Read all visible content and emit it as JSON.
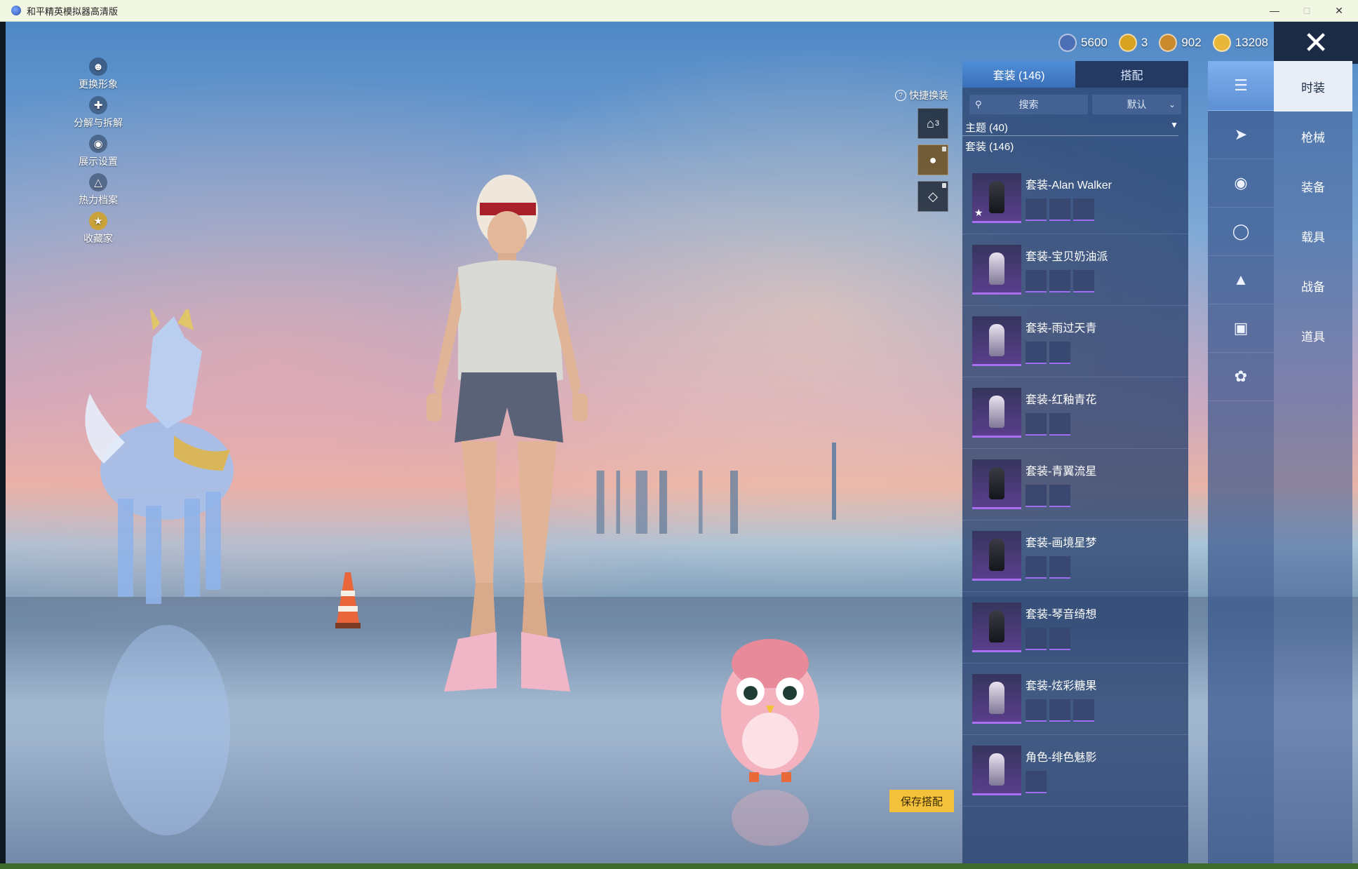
{
  "window": {
    "title": "和平精英模拟器高清版"
  },
  "currency": [
    {
      "icon": "silver-coin-icon",
      "value": "5600",
      "color": "#4c6fb5"
    },
    {
      "icon": "gold-medal-icon",
      "value": "3",
      "color": "#d6a21f"
    },
    {
      "icon": "bronze-coin-icon",
      "value": "902",
      "color": "#c98a2d"
    },
    {
      "icon": "gold-coin-icon",
      "value": "13208",
      "color": "#e8b73a"
    }
  ],
  "left_menu": [
    {
      "label": "更换形象",
      "icon": "avatar-icon"
    },
    {
      "label": "分解与拆解",
      "icon": "puzzle-icon"
    },
    {
      "label": "展示设置",
      "icon": "eye-icon"
    },
    {
      "label": "热力档案",
      "icon": "flame-icon"
    },
    {
      "label": "收藏家",
      "icon": "collector-badge-icon"
    }
  ],
  "quick_change": {
    "label": "快捷换装",
    "slot_number": "3"
  },
  "panel": {
    "tabs": [
      {
        "label": "套装 (146)"
      },
      {
        "label": "搭配"
      }
    ],
    "search_placeholder": "搜索",
    "sort_label": "默认",
    "theme_label": "主题 (40)",
    "set_count_label": "套装 (146)",
    "items": [
      {
        "name": "套装-Alan Walker",
        "minis": 3,
        "dark": true,
        "star": true
      },
      {
        "name": "套装-宝贝奶油派",
        "minis": 3,
        "dark": false,
        "star": false
      },
      {
        "name": "套装-雨过天青",
        "minis": 2,
        "dark": false,
        "star": false
      },
      {
        "name": "套装-红釉青花",
        "minis": 2,
        "dark": false,
        "star": false
      },
      {
        "name": "套装-青翼流星",
        "minis": 2,
        "dark": true,
        "star": false
      },
      {
        "name": "套装-画境星梦",
        "minis": 2,
        "dark": true,
        "star": false
      },
      {
        "name": "套装-琴音绮想",
        "minis": 2,
        "dark": true,
        "star": false
      },
      {
        "name": "套装-炫彩糖果",
        "minis": 3,
        "dark": false,
        "star": false
      },
      {
        "name": "角色-绯色魅影",
        "minis": 1,
        "dark": false,
        "star": false
      }
    ]
  },
  "categories": [
    {
      "label": "时装",
      "icon": "outfit-icon"
    },
    {
      "label": "枪械",
      "icon": "gun-icon"
    },
    {
      "label": "装备",
      "icon": "helmet-icon"
    },
    {
      "label": "载具",
      "icon": "vehicle-icon"
    },
    {
      "label": "战备",
      "icon": "parachute-icon"
    },
    {
      "label": "道具",
      "icon": "item-icon"
    }
  ],
  "extra_rail_icon": "emote-icon",
  "save_button": "保存搭配",
  "colors": {
    "accent_blue": "#3a6fb8",
    "save_yellow": "#f4c23a",
    "rarity_purple": "#a86ff0"
  }
}
